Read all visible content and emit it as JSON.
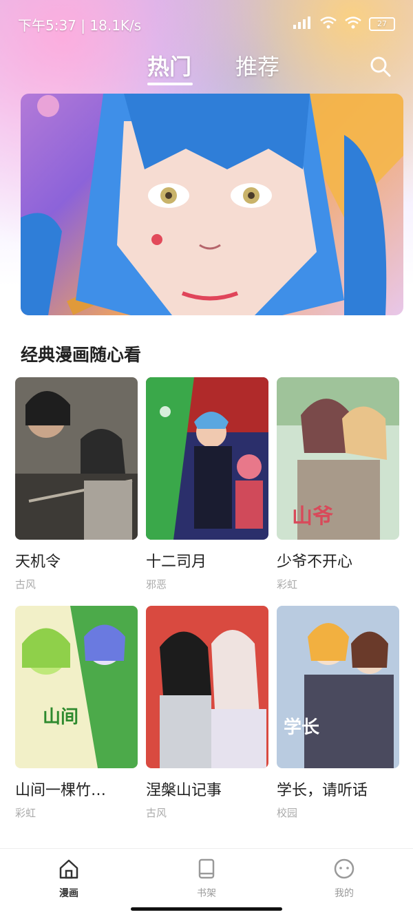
{
  "status_bar": {
    "time": "下午5:37",
    "speed": "18.1K/s",
    "battery": "27"
  },
  "top_tabs": [
    {
      "label": "热门",
      "active": true
    },
    {
      "label": "推荐",
      "active": false
    }
  ],
  "section": {
    "title": "经典漫画随心看"
  },
  "comics": [
    {
      "title": "天机令",
      "tag": "古风"
    },
    {
      "title": "十二司月",
      "tag": "邪恶"
    },
    {
      "title": "少爷不开心",
      "tag": "彩虹"
    },
    {
      "title": "山间一棵竹…",
      "tag": "彩虹"
    },
    {
      "title": "涅槃山记事",
      "tag": "古风"
    },
    {
      "title": "学长，请听话",
      "tag": "校园"
    }
  ],
  "bottom_nav": [
    {
      "label": "漫画",
      "icon": "home-icon",
      "active": true
    },
    {
      "label": "书架",
      "icon": "book-icon",
      "active": false
    },
    {
      "label": "我的",
      "icon": "profile-icon",
      "active": false
    }
  ],
  "colors": {
    "active_tab": "#ffffff",
    "tag_text": "#aaaaaa",
    "banner_hair": "#3f8fe8"
  }
}
